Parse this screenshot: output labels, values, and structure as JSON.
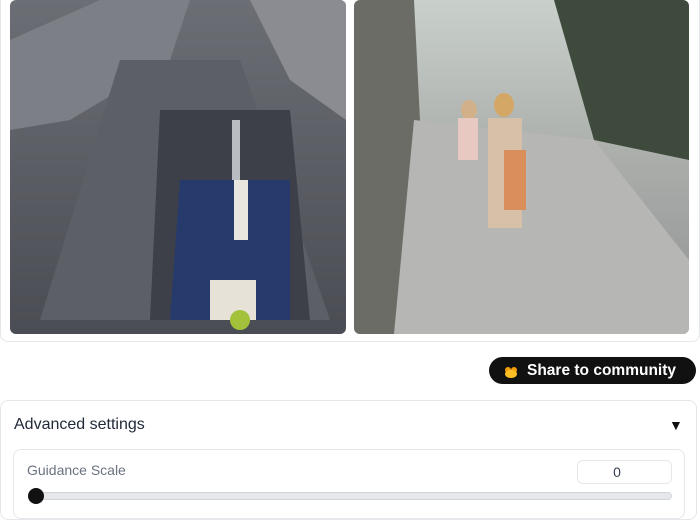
{
  "gallery": {
    "images": [
      {
        "name": "stone-monument-image"
      },
      {
        "name": "women-on-path-image"
      }
    ]
  },
  "share": {
    "label": "Share to community",
    "icon": "community-icon",
    "accent": "#f59e0b"
  },
  "advanced": {
    "title": "Advanced settings",
    "caret": "▼",
    "guidance": {
      "label": "Guidance Scale",
      "value": "0",
      "fraction": 0
    }
  }
}
